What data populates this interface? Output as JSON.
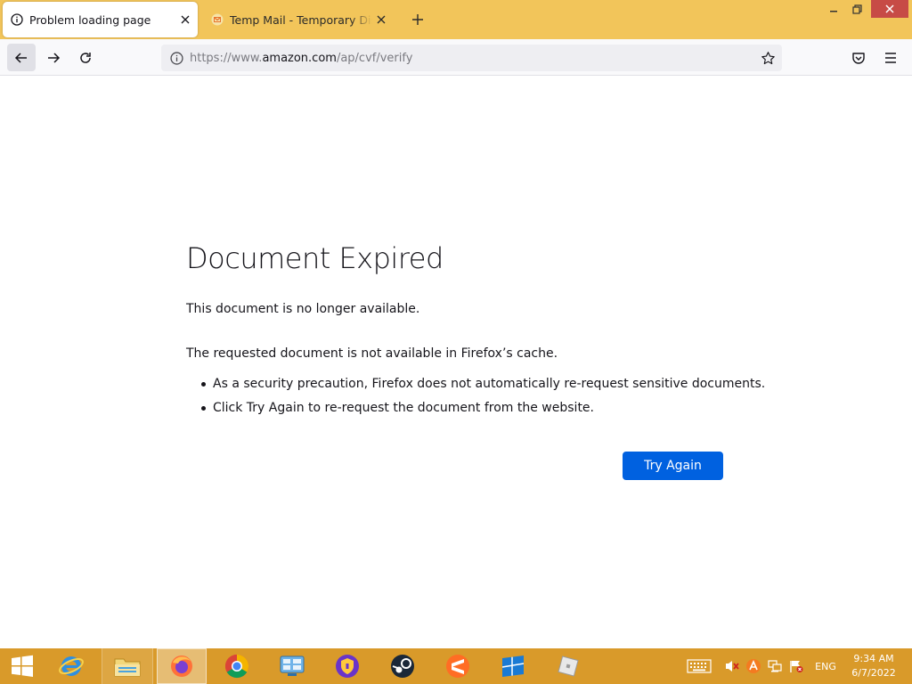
{
  "browser": {
    "tabs": [
      {
        "label": "Problem loading page",
        "active": true
      },
      {
        "label": "Temp Mail - Temporary Disposable",
        "active": false
      }
    ],
    "url": {
      "scheme": "https://www.",
      "host": "amazon.com",
      "path": "/ap/cvf/verify"
    }
  },
  "error_page": {
    "title": "Document Expired",
    "intro": "This document is no longer available.",
    "detail": "The requested document is not available in Firefox’s cache.",
    "bullets": [
      "As a security precaution, Firefox does not automatically re-request sensitive documents.",
      "Click Try Again to re-request the document from the website."
    ],
    "try_again_label": "Try Again"
  },
  "taskbar": {
    "language": "ENG",
    "time": "9:34 AM",
    "date": "6/7/2022"
  },
  "colors": {
    "tab_strip": "#f2c55a",
    "accent_button": "#0061e0",
    "taskbar": "#d99a2a",
    "close_button": "#c74b46"
  }
}
